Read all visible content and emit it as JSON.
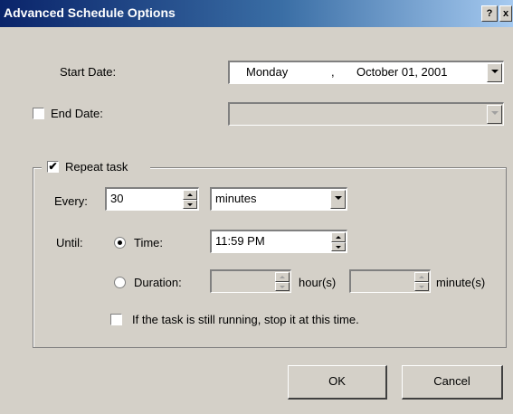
{
  "window": {
    "title": "Advanced Schedule Options",
    "help_label": "?",
    "close_label": "x"
  },
  "start_date": {
    "label": "Start Date:",
    "day": "Monday",
    "separator": ",",
    "month_day": "October  01, 2001"
  },
  "end_date": {
    "label": "End Date:",
    "checked": false,
    "value": ""
  },
  "repeat": {
    "label": "Repeat task",
    "checked": true,
    "check_mark": "✔",
    "every_label": "Every:",
    "every_value": "30",
    "unit_value": "minutes",
    "until_label": "Until:",
    "time_label": "Time:",
    "time_value": "11:59 PM",
    "time_selected": true,
    "duration_label": "Duration:",
    "hours_value": "",
    "hours_label": "hour(s)",
    "minutes_value": "",
    "minutes_label": "minute(s)",
    "stop_label": "If the task is still running, stop it at this time.",
    "stop_checked": false
  },
  "buttons": {
    "ok": "OK",
    "cancel": "Cancel"
  },
  "colors": {
    "title_gradient_start": "#0a246a",
    "face": "#d4d0c8"
  }
}
